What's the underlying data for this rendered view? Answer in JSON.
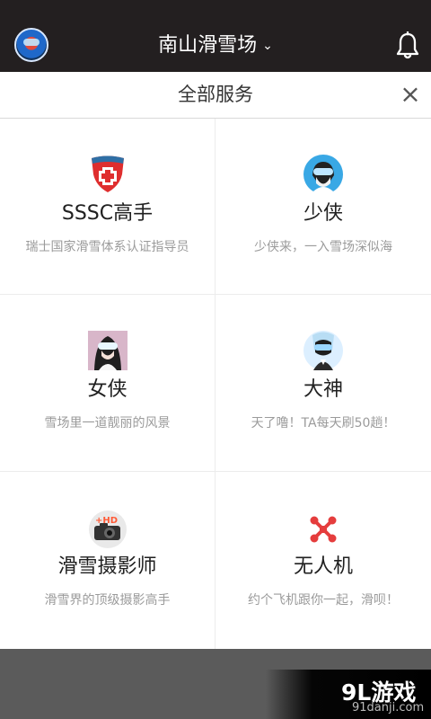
{
  "header": {
    "title": "南山滑雪场",
    "dropdown_icon": "chevron-down-icon",
    "avatar_icon": "skier-avatar",
    "notification_icon": "bell-icon"
  },
  "sheet": {
    "title": "全部服务",
    "close_icon": "close-icon"
  },
  "services": [
    {
      "name": "SSSC高手",
      "description": "瑞士国家滑雪体系认证指导员",
      "icon": "swiss-shield-icon"
    },
    {
      "name": "少侠",
      "description": "少侠来，一入雪场深似海",
      "icon": "male-skier-avatar-icon"
    },
    {
      "name": "女侠",
      "description": "雪场里一道靓丽的风景",
      "icon": "female-skier-avatar-icon"
    },
    {
      "name": "大神",
      "description": "天了噜！TA每天刷50趟！",
      "icon": "expert-skier-avatar-icon"
    },
    {
      "name": "滑雪摄影师",
      "description": "滑雪界的顶级摄影高手",
      "icon": "camera-hd-icon"
    },
    {
      "name": "无人机",
      "description": "约个飞机跟你一起，滑呗！",
      "icon": "drone-icon"
    }
  ],
  "watermark": {
    "main": "9L游戏",
    "sub": "91danji.com"
  },
  "colors": {
    "topbar": "#231f20",
    "sheet_bg": "#ffffff",
    "text_primary": "#202020",
    "text_secondary": "#9b9b9b",
    "overlay": "#5b5b5b",
    "drone_red": "#e53d3d"
  }
}
